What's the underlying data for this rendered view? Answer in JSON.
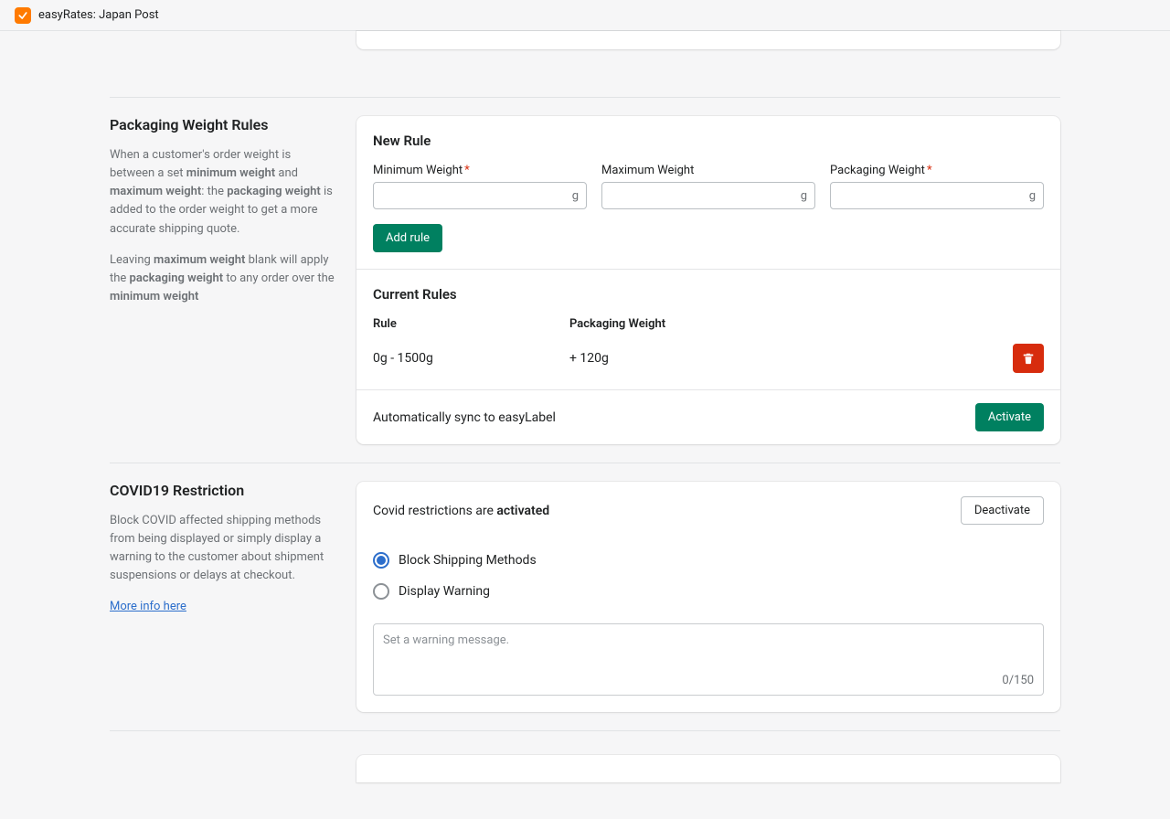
{
  "app": {
    "title": "easyRates: Japan Post"
  },
  "packaging": {
    "title": "Packaging Weight Rules",
    "desc1_pre": "When a customer's order weight is between a set ",
    "desc1_min": "minimum weight",
    "desc1_and": " and ",
    "desc1_max": "maximum weight",
    "desc1_colon": ": the ",
    "desc1_pkg": "packaging weight",
    "desc1_post": " is added to the order weight to get a more accurate shipping quote.",
    "desc2_pre": "Leaving ",
    "desc2_max": "maximum weight",
    "desc2_mid": " blank will apply the ",
    "desc2_pkg": "packaging weight",
    "desc2_mid2": " to any order over the ",
    "desc2_min": "minimum weight",
    "new_rule_title": "New Rule",
    "min_label": "Minimum Weight",
    "max_label": "Maximum Weight",
    "pkg_label": "Packaging Weight",
    "unit": "g",
    "add_btn": "Add rule",
    "current_title": "Current Rules",
    "col_rule": "Rule",
    "col_weight": "Packaging Weight",
    "rules": [
      {
        "range": "0g - 1500g",
        "weight": "+ 120g"
      }
    ],
    "sync_text": "Automatically sync to easyLabel",
    "activate_btn": "Activate"
  },
  "covid": {
    "title": "COVID19 Restriction",
    "desc": "Block COVID affected shipping methods from being displayed or simply display a warning to the customer about shipment suspensions or delays at checkout.",
    "more_link": "More info here",
    "status_pre": "Covid restrictions are ",
    "status_state": "activated",
    "deactivate_btn": "Deactivate",
    "opt_block": "Block Shipping Methods",
    "opt_warn": "Display Warning",
    "placeholder": "Set a warning message.",
    "char_count": "0/150"
  }
}
